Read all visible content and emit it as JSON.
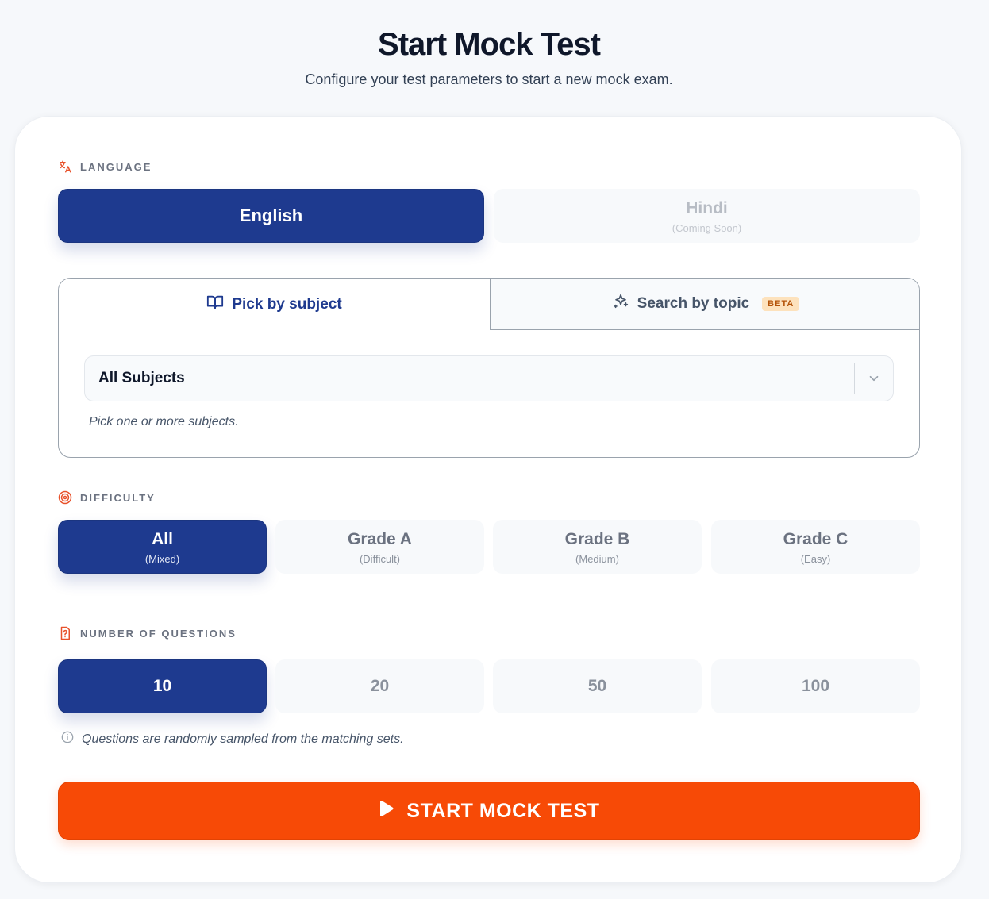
{
  "header": {
    "title": "Start Mock Test",
    "subtitle": "Configure your test parameters to start a new mock exam."
  },
  "language": {
    "label": "LANGUAGE",
    "icon": "translate-icon",
    "options": [
      {
        "label": "English",
        "sub": "",
        "selected": true,
        "disabled": false
      },
      {
        "label": "Hindi",
        "sub": "(Coming Soon)",
        "selected": false,
        "disabled": true
      }
    ]
  },
  "mode_tabs": {
    "tabs": [
      {
        "label": "Pick by subject",
        "icon": "book-open-icon",
        "active": true
      },
      {
        "label": "Search by topic",
        "icon": "sparkles-icon",
        "active": false,
        "badge": "BETA"
      }
    ],
    "subject_select": {
      "value": "All Subjects",
      "helper": "Pick one or more subjects."
    }
  },
  "difficulty": {
    "label": "DIFFICULTY",
    "icon": "target-icon",
    "options": [
      {
        "label": "All",
        "sub": "(Mixed)",
        "selected": true
      },
      {
        "label": "Grade A",
        "sub": "(Difficult)",
        "selected": false
      },
      {
        "label": "Grade B",
        "sub": "(Medium)",
        "selected": false
      },
      {
        "label": "Grade C",
        "sub": "(Easy)",
        "selected": false
      }
    ]
  },
  "question_count": {
    "label": "NUMBER OF QUESTIONS",
    "icon": "question-file-icon",
    "options": [
      {
        "label": "10",
        "selected": true
      },
      {
        "label": "20",
        "selected": false
      },
      {
        "label": "50",
        "selected": false
      },
      {
        "label": "100",
        "selected": false
      }
    ],
    "note": "Questions are randomly sampled from the matching sets."
  },
  "start_button": {
    "label": "START MOCK TEST",
    "icon": "play-icon"
  },
  "colors": {
    "primary": "#1e3a8f",
    "accent": "#f74a06",
    "section_icon": "#e8522b",
    "badge_bg": "#fde2bd",
    "badge_text": "#b45309"
  }
}
